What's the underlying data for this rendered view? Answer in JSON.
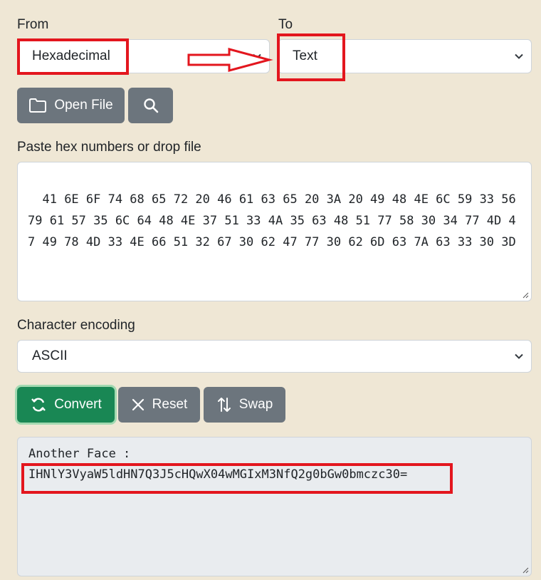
{
  "from": {
    "label": "From",
    "selected": "Hexadecimal"
  },
  "to": {
    "label": "To",
    "selected": "Text"
  },
  "toolbar": {
    "open_file_label": "Open File"
  },
  "input": {
    "label": "Paste hex numbers or drop file",
    "value": "41 6E 6F 74 68 65 72 20 46 61 63 65 20 3A 20 49 48 4E 6C 59 33 56 79 61 57 35 6C 64 48 4E 37 51 33 4A 35 63 48 51 77 58 30 34 77 4D 47 49 78 4D 33 4E 66 51 32 67 30 62 47 77 30 62 6D 63 7A 63 33 30 3D"
  },
  "encoding": {
    "label": "Character encoding",
    "selected": "ASCII"
  },
  "actions": {
    "convert_label": "Convert",
    "reset_label": "Reset",
    "swap_label": "Swap"
  },
  "output": {
    "line1": "Another Face :",
    "line2": "IHNlY3VyaW5ldHN7Q3J5cHQwX04wMGIxM3NfQ2g0bGw0bmczc30="
  },
  "colors": {
    "background": "#efe7d5",
    "highlight_red": "#e3161e",
    "button_gray": "#6c757d",
    "button_green": "#198754"
  }
}
